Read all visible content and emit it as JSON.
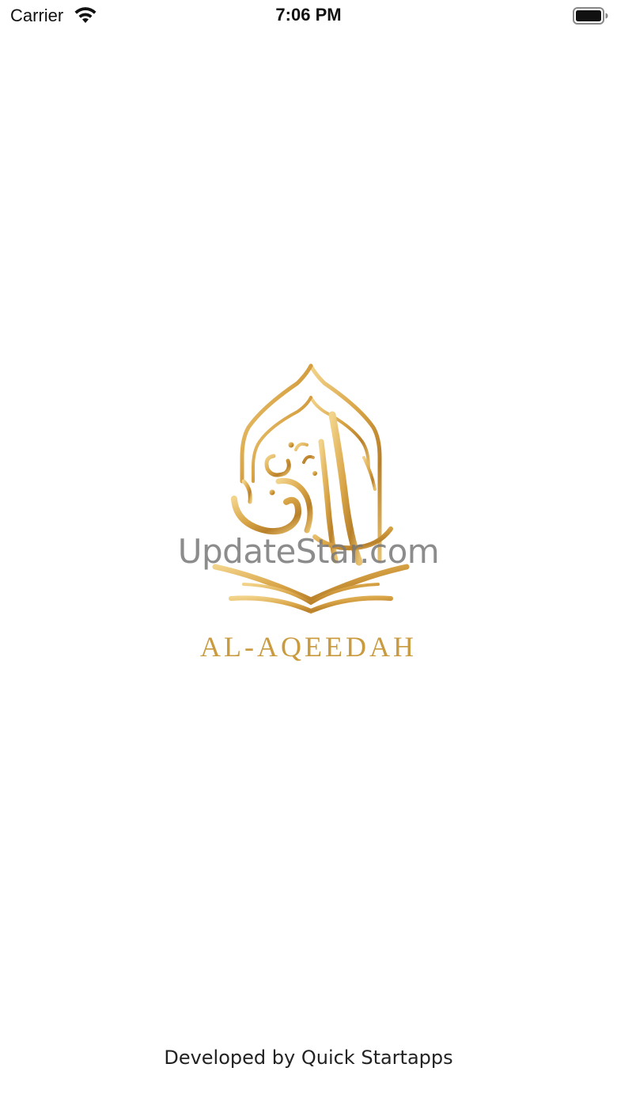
{
  "status_bar": {
    "carrier": "Carrier",
    "time": "7:06 PM",
    "wifi_icon": "wifi-icon",
    "battery_icon": "battery-icon"
  },
  "splash": {
    "logo_icon": "al-aqeedah-logo",
    "brand_name": "AL-AQEEDAH",
    "accent_color": "#c99a3e"
  },
  "watermark": {
    "text": "UpdateStar.com"
  },
  "footer": {
    "credit": "Developed by Quick Startapps"
  }
}
